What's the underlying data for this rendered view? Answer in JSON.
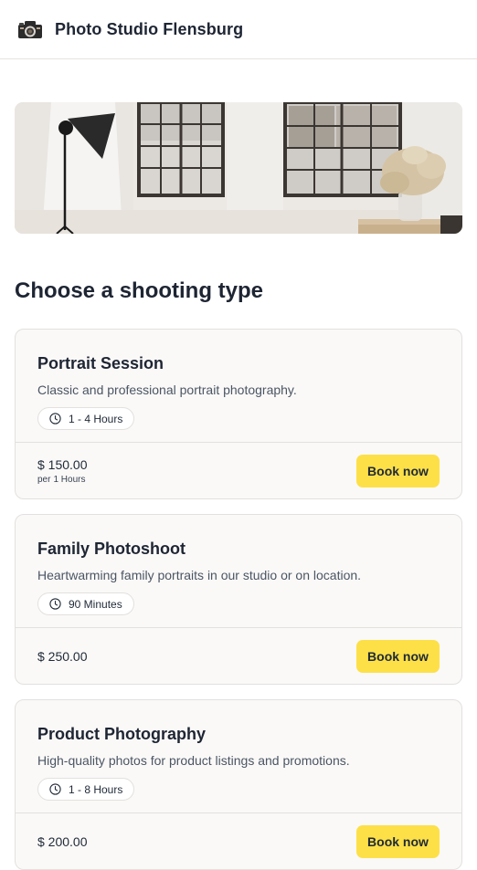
{
  "header": {
    "brand": "Photo Studio Flensburg",
    "logo_icon": "camera-logo-icon"
  },
  "hero": {
    "image": "studio-interior-photo"
  },
  "main": {
    "section_title": "Choose a shooting type",
    "button_color": "#fde047",
    "cards": [
      {
        "title": "Portrait Session",
        "description": "Classic and professional portrait photography.",
        "duration": "1 - 4 Hours",
        "price": "$ 150.00",
        "per_label": "per",
        "per_value": "1 Hours",
        "button_label": "Book now"
      },
      {
        "title": "Family Photoshoot",
        "description": "Heartwarming family portraits in our studio or on location.",
        "duration": "90 Minutes",
        "price": "$ 250.00",
        "button_label": "Book now"
      },
      {
        "title": "Product Photography",
        "description": "High-quality photos for product listings and promotions.",
        "duration": "1 - 8 Hours",
        "price": "$ 200.00",
        "button_label": "Book now"
      }
    ]
  }
}
